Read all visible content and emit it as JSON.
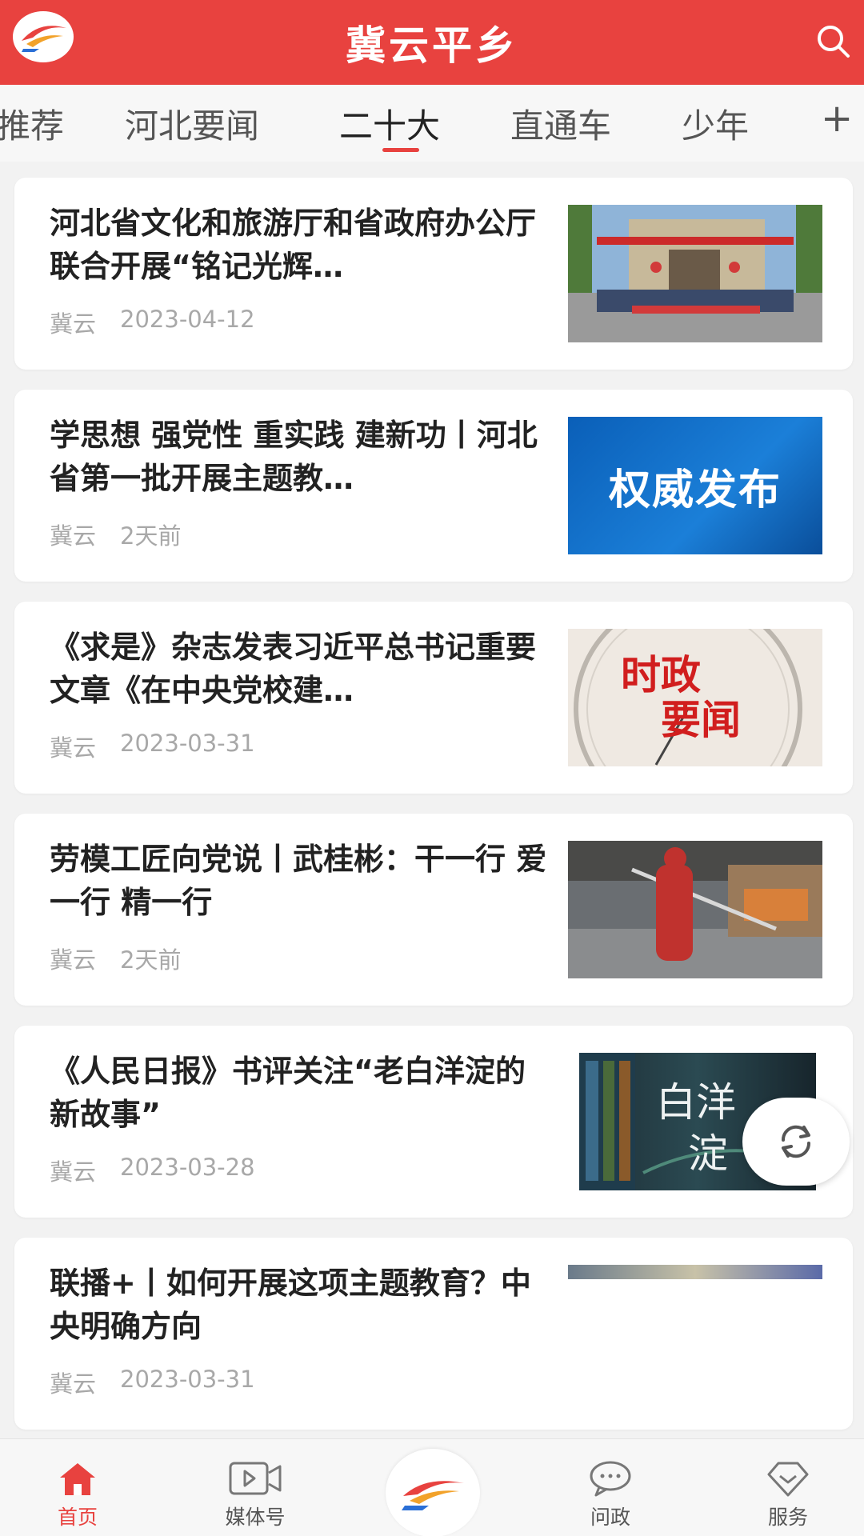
{
  "header": {
    "title": "冀云平乡",
    "logo_icon": "app-logo-icon",
    "search_icon": "search-icon"
  },
  "tabs": [
    {
      "label": "推荐"
    },
    {
      "label": "河北要闻"
    },
    {
      "label": "二十大"
    },
    {
      "label": "直通车"
    },
    {
      "label": "少年"
    }
  ],
  "tabs_more": "+",
  "active_tab": "二十大",
  "articles": [
    {
      "title": "河北省文化和旅游厅和省政府办公厅联合开展“铭记光辉…",
      "source": "冀云",
      "time": "2023-04-12"
    },
    {
      "title": "学思想 强党性 重实践 建新功丨河北省第一批开展主题教…",
      "source": "冀云",
      "time": "2天前",
      "thumb_text": "权威发布"
    },
    {
      "title": "《求是》杂志发表习近平总书记重要文章《在中央党校建…",
      "source": "冀云",
      "time": "2023-03-31",
      "thumb_line1": "时政",
      "thumb_line2": "要闻"
    },
    {
      "title": "劳模工匠向党说丨武桂彬：干一行 爱一行 精一行",
      "source": "冀云",
      "time": "2天前"
    },
    {
      "title": "《人民日报》书评关注“老白洋淀的新故事”",
      "source": "冀云",
      "time": "2023-03-28",
      "thumb_line1": "白洋",
      "thumb_line2": "淀"
    },
    {
      "title": "联播+丨如何开展这项主题教育？中央明确方向",
      "source": "冀云",
      "time": "2023-03-31"
    }
  ],
  "bottom_nav": [
    {
      "label": "首页",
      "icon": "home-icon"
    },
    {
      "label": "媒体号",
      "icon": "video-icon"
    },
    {
      "label": "问政",
      "icon": "chat-icon"
    },
    {
      "label": "服务",
      "icon": "service-icon"
    }
  ],
  "colors": {
    "brand": "#e8423f",
    "meta": "#a8a8a8"
  }
}
